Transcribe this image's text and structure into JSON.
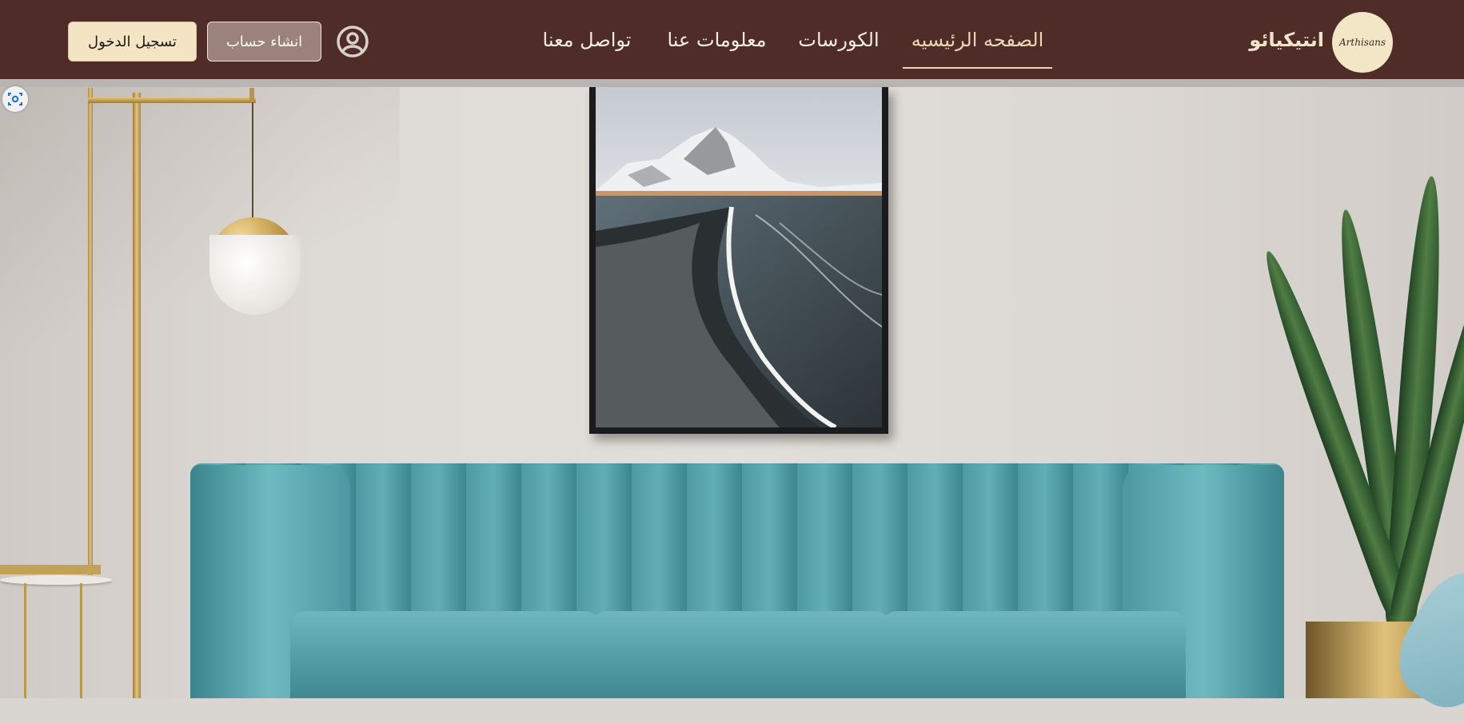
{
  "brand": {
    "logo_text": "Arthisans",
    "name": "انتيكيائو"
  },
  "nav": {
    "items": [
      {
        "label": "الصفحه الرئيسيه",
        "active": true
      },
      {
        "label": "الكورسات",
        "active": false
      },
      {
        "label": "معلومات عنا",
        "active": false
      },
      {
        "label": "تواصل معنا",
        "active": false
      }
    ]
  },
  "auth": {
    "profile_icon": "user-circle-icon",
    "signup_label": "انشاء حساب",
    "login_label": "تسجيل الدخول"
  },
  "hero": {
    "scan_icon": "scan-icon",
    "description": ""
  },
  "colors": {
    "navbar_bg": "#502c29",
    "accent_cream": "#f3e4c4",
    "signup_bg": "#9b827a",
    "active_link": "#ecd7b5"
  }
}
